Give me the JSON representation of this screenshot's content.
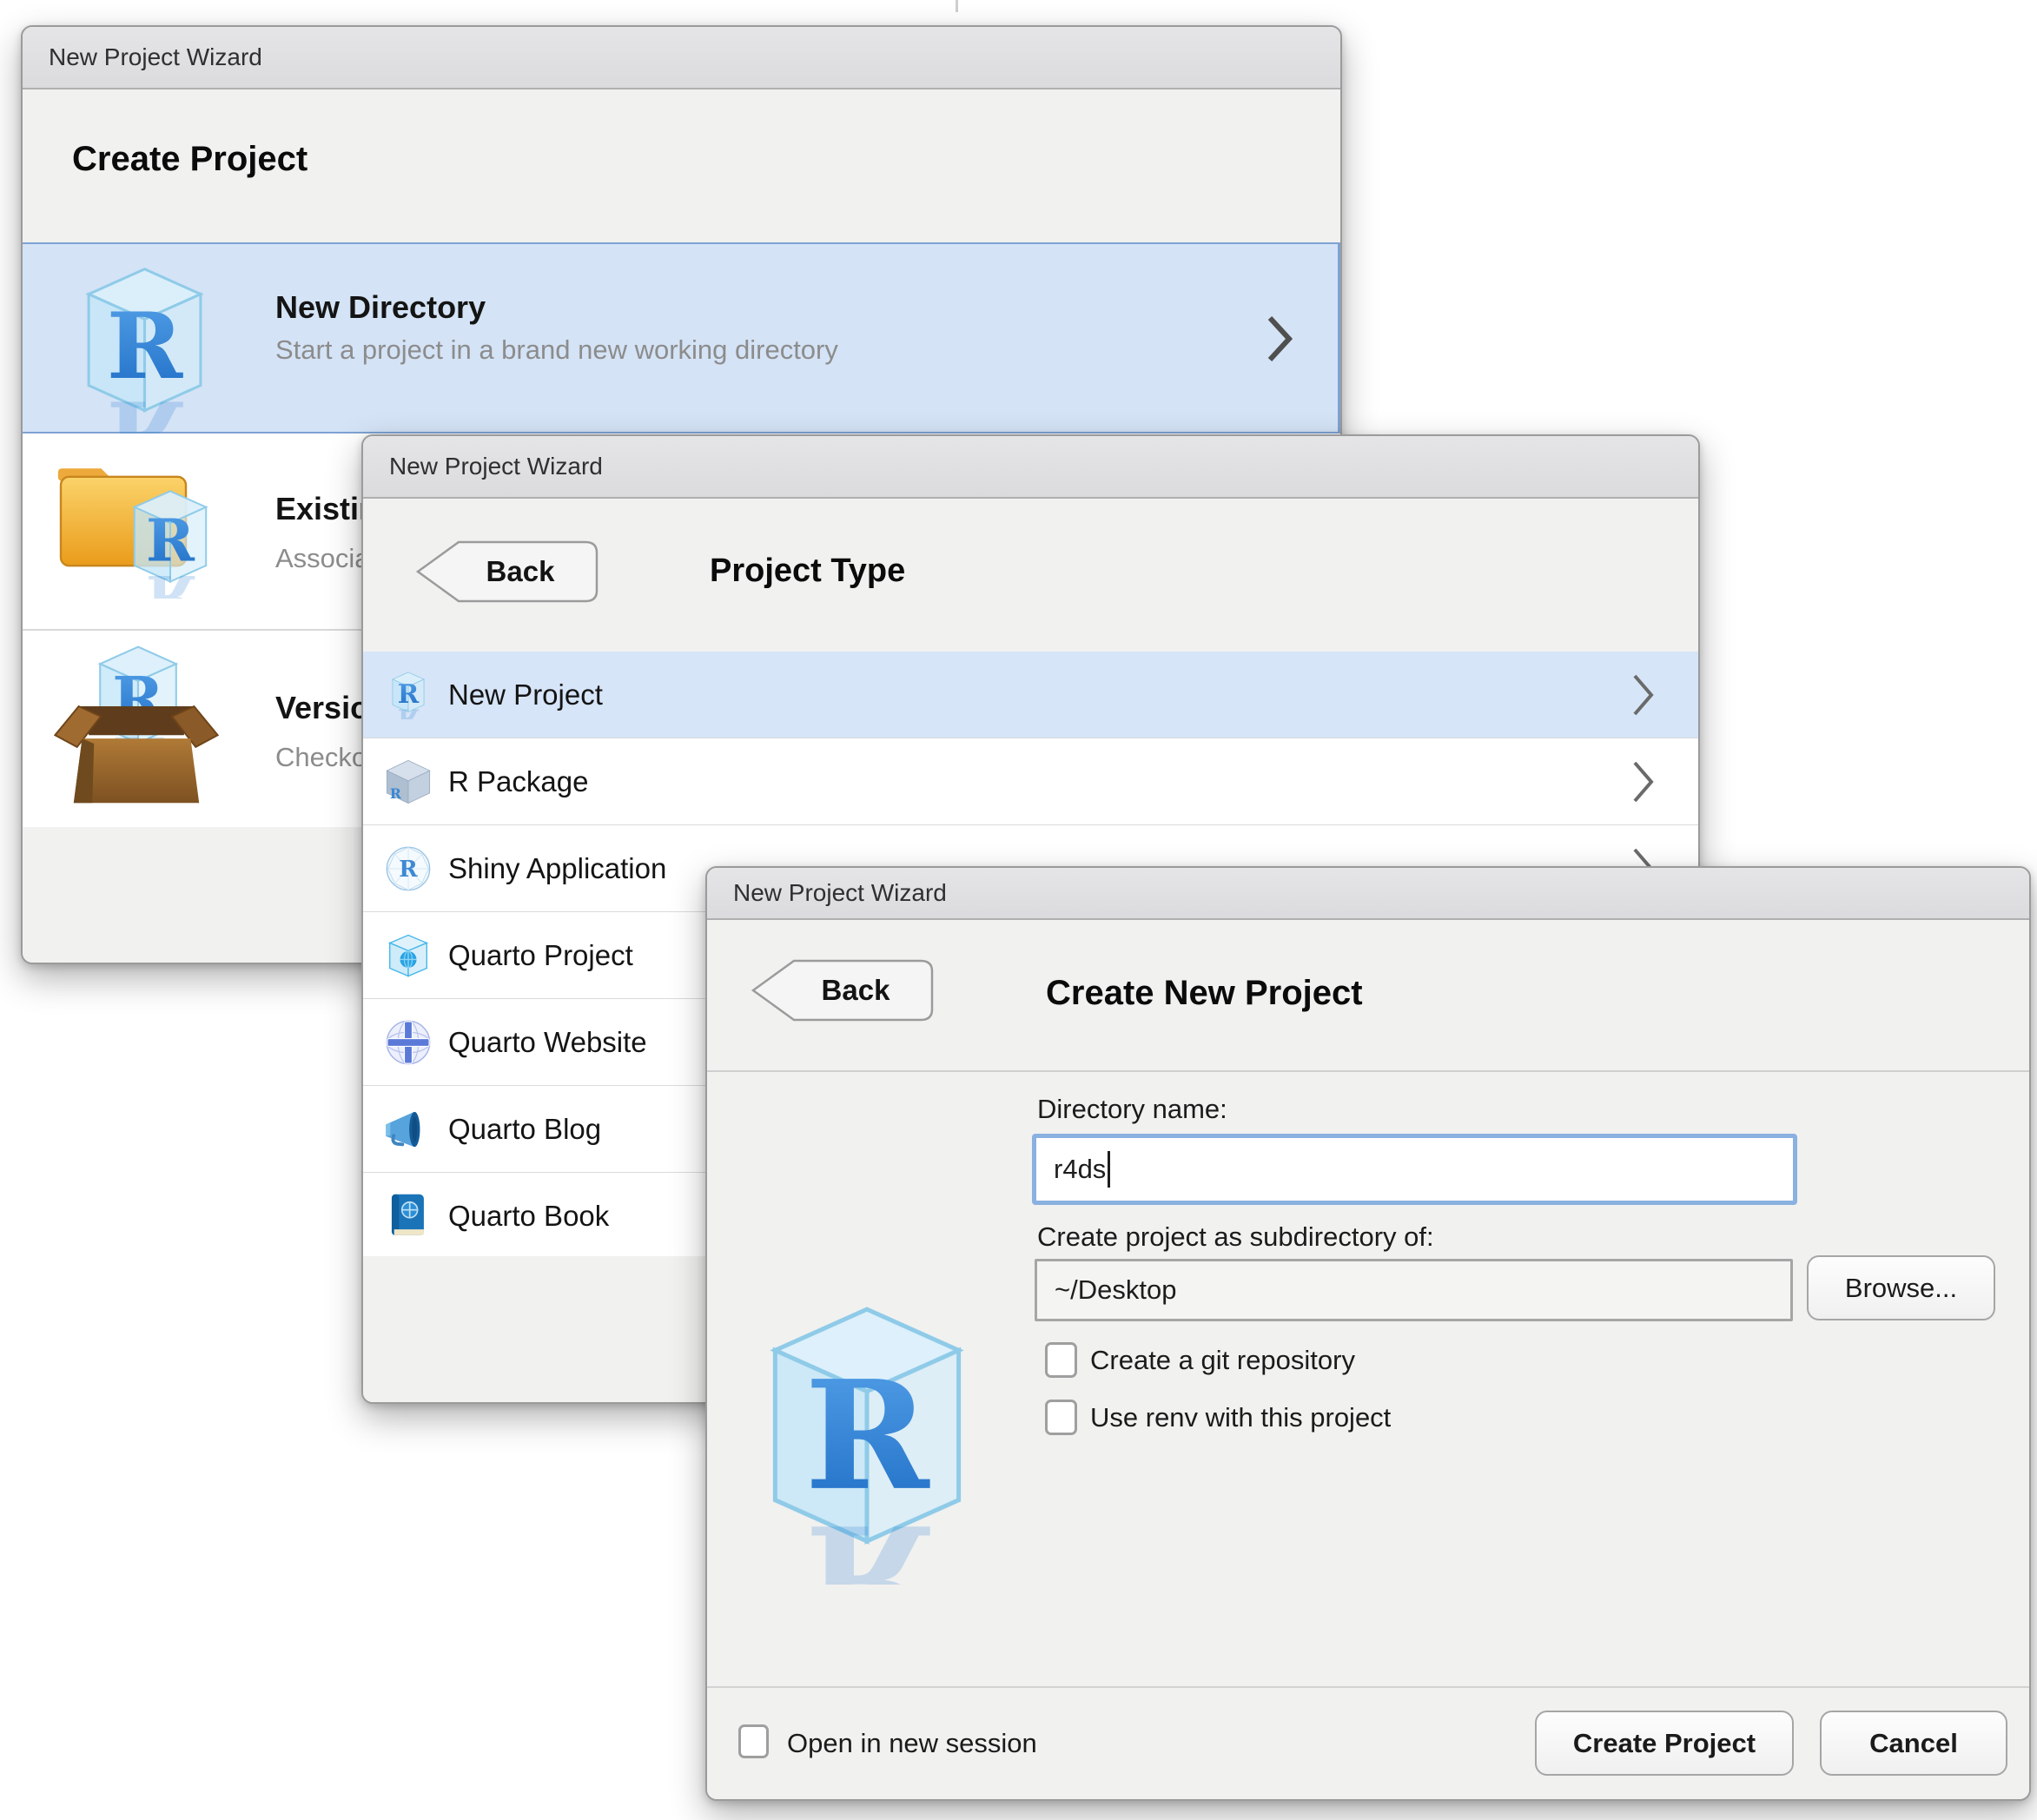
{
  "colors": {
    "selection_blue": "#d6e5f7",
    "selection_border_blue": "#7ea3d3",
    "focus_ring_blue": "#8ab1e0",
    "r_logo_blue": "#2e7fd6",
    "titlebar_gray": "#dfdfe1",
    "dialog_bg": "#f1f1ef"
  },
  "window1": {
    "title": "New Project Wizard",
    "heading": "Create Project",
    "items": [
      {
        "title": "New Directory",
        "subtitle": "Start a project in a brand new working directory",
        "icon": "r-cube",
        "selected": true
      },
      {
        "title": "Existing Directory",
        "subtitle": "Associate a project with an existing working directory",
        "icon": "folder-r-cube",
        "selected": false
      },
      {
        "title": "Version Control",
        "subtitle": "Checkout a project from a version control repository",
        "icon": "box-r-cube",
        "selected": false
      }
    ]
  },
  "window2": {
    "title": "New Project Wizard",
    "back_label": "Back",
    "heading": "Project Type",
    "items": [
      {
        "label": "New Project",
        "icon": "r-cube",
        "selected": true
      },
      {
        "label": "R Package",
        "icon": "package-cube",
        "selected": false
      },
      {
        "label": "Shiny Application",
        "icon": "shiny-circle-r",
        "selected": false
      },
      {
        "label": "Quarto Project",
        "icon": "quarto-cube-globe",
        "selected": false
      },
      {
        "label": "Quarto Website",
        "icon": "quarto-globe",
        "selected": false
      },
      {
        "label": "Quarto Blog",
        "icon": "quarto-megaphone",
        "selected": false
      },
      {
        "label": "Quarto Book",
        "icon": "quarto-book",
        "selected": false
      }
    ]
  },
  "window3": {
    "title": "New Project Wizard",
    "back_label": "Back",
    "heading": "Create New Project",
    "directory_name_label": "Directory name:",
    "directory_name_value": "r4ds",
    "subdirectory_label": "Create project as subdirectory of:",
    "subdirectory_value": "~/Desktop",
    "browse_label": "Browse...",
    "git_checkbox_label": "Create a git repository",
    "renv_checkbox_label": "Use renv with this project",
    "open_session_checkbox_label": "Open in new session",
    "create_button_label": "Create Project",
    "cancel_button_label": "Cancel"
  }
}
